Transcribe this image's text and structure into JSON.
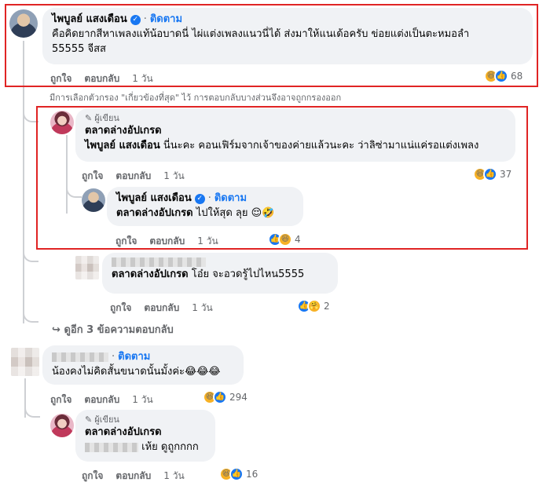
{
  "comment1": {
    "name": "ไพบูลย์ แสงเดือน",
    "follow": "ติดตาม",
    "text": "คือคิดยากสีหาเพลงแท้น้อบาดนี่ ไผ่แต่งเพลงแนวนี่ได้ ส่งมาให้แนเด้อครับ ข่อยแต่งเป็นตะหมอลำ",
    "text2": "55555 จีสส",
    "like": "ถูกใจ",
    "reply": "ตอบกลับ",
    "time": "1 วัน",
    "reaction_count": "68"
  },
  "filter_note": "มีการเลือกตัวกรอง \"เกี่ยวข้องที่สุด\" ไว้ การตอบกลับบางส่วนจึงอาจถูกกรองออก",
  "reply1": {
    "badge": "ผู้เขียน",
    "name": "ตลาดล่างอัปเกรด",
    "tag": "ไพบูลย์ แสงเดือน",
    "text": " นี่นะคะ คอนเฟิร์มจากเจ้าของค่ายแล้วนะคะ ว่าลิซ่ามาแน่แค่รอแต่งเพลง",
    "like": "ถูกใจ",
    "reply": "ตอบกลับ",
    "time": "1 วัน",
    "reaction_count": "37"
  },
  "reply2": {
    "name": "ไพบูลย์ แสงเดือน",
    "follow": "ติดตาม",
    "tag": "ตลาดล่างอัปเกรด",
    "text": " ไปให้สุด ลุย 😌🤣",
    "like": "ถูกใจ",
    "reply": "ตอบกลับ",
    "time": "1 วัน",
    "reaction_count": "4"
  },
  "reply3": {
    "tag": "ตลาดล่างอัปเกรด",
    "text": " โอ๋ย จะอวดรู้ไปไหน5555",
    "like": "ถูกใจ",
    "reply": "ตอบกลับ",
    "time": "1 วัน",
    "reaction_count": "2"
  },
  "more_replies": "ดูอีก 3 ข้อความตอบกลับ",
  "comment2": {
    "follow": "ติดตาม",
    "text": "น้องคงไม่คิดสั้นขนาดนั้นมั้งค่ะ😂😂😂",
    "like": "ถูกใจ",
    "reply": "ตอบกลับ",
    "time": "1 วัน",
    "reaction_count": "294"
  },
  "reply4": {
    "badge": "ผู้เขียน",
    "name": "ตลาดล่างอัปเกรด",
    "text": " เห้ย ดูถูกกกก",
    "like": "ถูกใจ",
    "reply": "ตอบกลับ",
    "time": "1 วัน",
    "reaction_count": "16"
  },
  "colors": {
    "link": "#1877f2",
    "highlight": "#e02424",
    "bubble": "#f0f2f5",
    "muted": "#65676b"
  }
}
